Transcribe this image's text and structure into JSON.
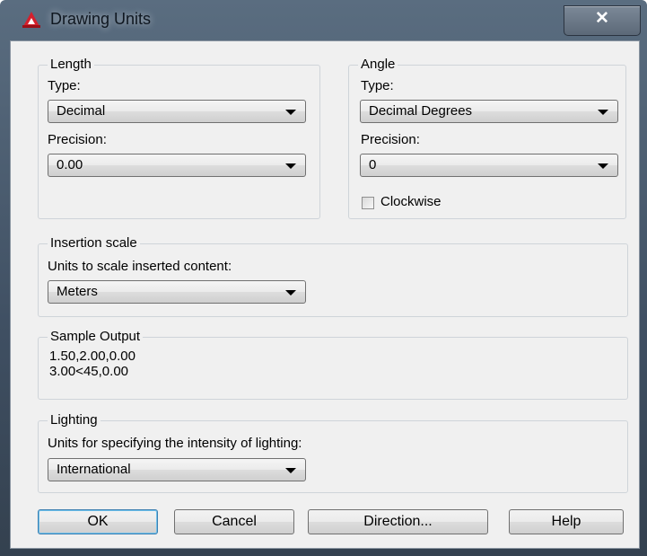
{
  "window": {
    "title": "Drawing Units",
    "close_label": "✕",
    "app_icon": "autocad-a-icon"
  },
  "length": {
    "legend": "Length",
    "type_label": "Type:",
    "type_value": "Decimal",
    "precision_label": "Precision:",
    "precision_value": "0.00"
  },
  "angle": {
    "legend": "Angle",
    "type_label": "Type:",
    "type_value": "Decimal Degrees",
    "precision_label": "Precision:",
    "precision_value": "0",
    "clockwise_label": "Clockwise",
    "clockwise_checked": false
  },
  "insertion": {
    "legend": "Insertion scale",
    "units_label": "Units to scale inserted content:",
    "units_value": "Meters"
  },
  "sample": {
    "legend": "Sample Output",
    "line1": "1.50,2.00,0.00",
    "line2": "3.00<45,0.00"
  },
  "lighting": {
    "legend": "Lighting",
    "units_label": "Units for specifying the intensity of lighting:",
    "units_value": "International"
  },
  "buttons": {
    "ok": "OK",
    "cancel": "Cancel",
    "direction": "Direction...",
    "help": "Help"
  },
  "colors": {
    "titlebar": "#4a5b6e",
    "dialog_bg": "#f0f0f0",
    "icon_red": "#d4202c"
  }
}
